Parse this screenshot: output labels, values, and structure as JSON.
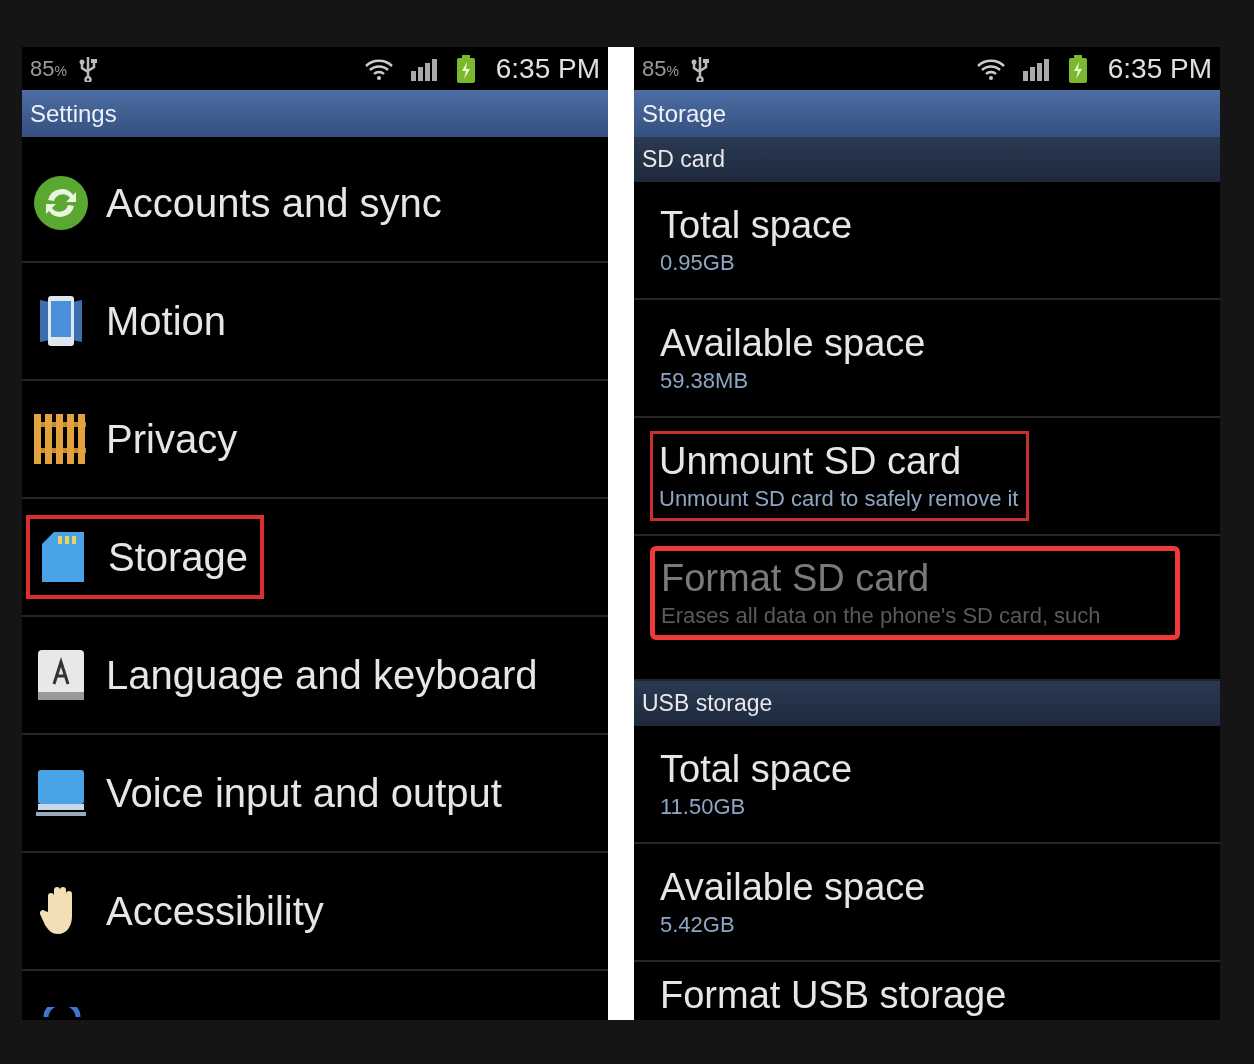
{
  "left_screen": {
    "status_bar": {
      "battery_percent": "85",
      "percent_sign": "%",
      "time": "6:35 PM"
    },
    "title": "Settings",
    "items": [
      {
        "label": "Accounts and sync",
        "highlighted": false
      },
      {
        "label": "Motion",
        "highlighted": false
      },
      {
        "label": "Privacy",
        "highlighted": false
      },
      {
        "label": "Storage",
        "highlighted": true
      },
      {
        "label": "Language and keyboard",
        "highlighted": false
      },
      {
        "label": "Voice input and output",
        "highlighted": false
      },
      {
        "label": "Accessibility",
        "highlighted": false
      }
    ]
  },
  "right_screen": {
    "status_bar": {
      "battery_percent": "85",
      "percent_sign": "%",
      "time": "6:35 PM"
    },
    "title": "Storage",
    "sections": [
      {
        "header": "SD card",
        "rows": [
          {
            "title": "Total space",
            "subtitle": "0.95GB",
            "highlighted": false,
            "disabled": false
          },
          {
            "title": "Available space",
            "subtitle": "59.38MB",
            "highlighted": false,
            "disabled": false
          },
          {
            "title": "Unmount SD card",
            "subtitle": "Unmount SD card to safely remove it",
            "highlighted": true,
            "disabled": false
          },
          {
            "title": "Format SD card",
            "subtitle": "Erases all data on the phone's SD card, such",
            "highlighted": true,
            "disabled": true
          }
        ]
      },
      {
        "header": "USB storage",
        "rows": [
          {
            "title": "Total space",
            "subtitle": "11.50GB",
            "highlighted": false,
            "disabled": false
          },
          {
            "title": "Available space",
            "subtitle": "5.42GB",
            "highlighted": false,
            "disabled": false
          },
          {
            "title": "Format USB storage",
            "highlighted": false,
            "disabled": false
          }
        ]
      }
    ]
  }
}
